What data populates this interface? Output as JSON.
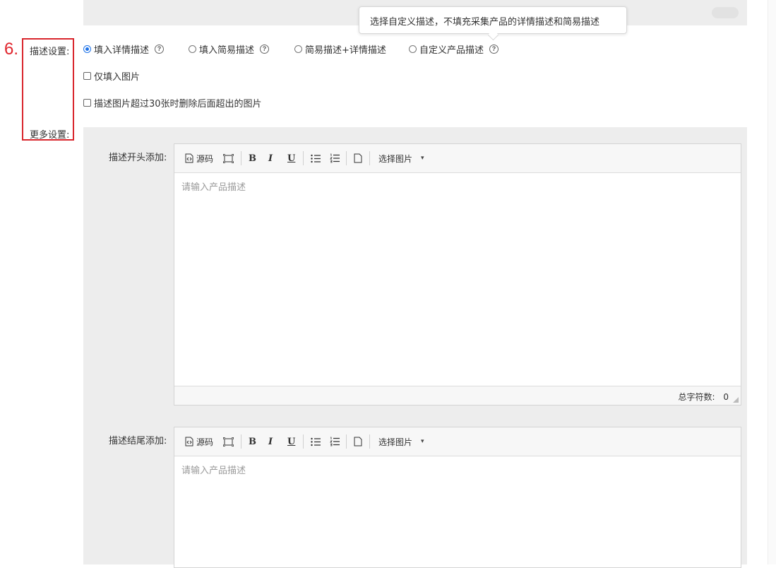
{
  "step_marker": "6.",
  "description_settings": {
    "label": "描述设置:",
    "options": [
      {
        "label": "填入详情描述",
        "checked": true,
        "help": true
      },
      {
        "label": "填入简易描述",
        "checked": false,
        "help": true
      },
      {
        "label": "简易描述+详情描述",
        "checked": false,
        "help": false
      },
      {
        "label": "自定义产品描述",
        "checked": false,
        "help": true
      }
    ],
    "help_glyph": "?",
    "checkbox_image_only": "仅填入图片",
    "checkbox_delete_extra": "描述图片超过30张时删除后面超出的图片"
  },
  "tooltip": {
    "text": "选择自定义描述，不填充采集产品的详情描述和简易描述"
  },
  "more_settings": {
    "label": "更多设置:",
    "editors": [
      {
        "label": "描述开头添加:",
        "placeholder": "请输入产品描述",
        "char_count_label": "总字符数:",
        "char_count": "0"
      },
      {
        "label": "描述结尾添加:",
        "placeholder": "请输入产品描述"
      }
    ],
    "toolbar": {
      "source_label": "源码",
      "bold": "B",
      "italic": "I",
      "underline": "U",
      "select_image_label": "选择图片",
      "dropdown_caret": "▾"
    }
  },
  "colors": {
    "accent": "#1d72e8",
    "highlight_red": "#d9262d",
    "panel_gray": "#ededed"
  }
}
